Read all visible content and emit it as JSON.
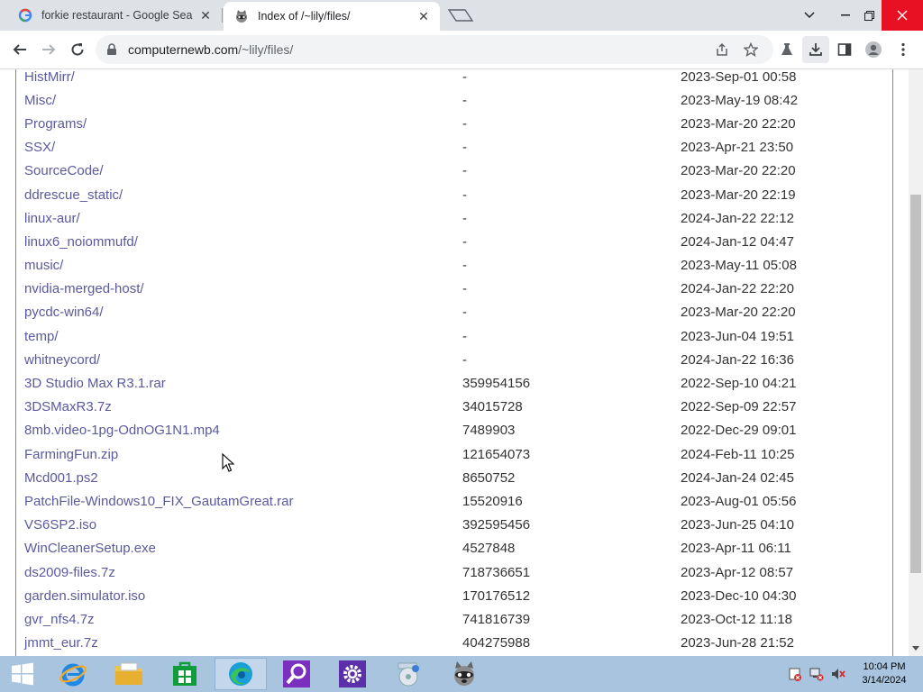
{
  "browser": {
    "tabs": [
      {
        "title": "forkie restaurant - Google Search",
        "favicon": "google-icon",
        "active": false
      },
      {
        "title": "Index of /~lily/files/",
        "favicon": "raccoon-icon",
        "active": true
      }
    ],
    "url_host": "computernewb.com",
    "url_path": "/~lily/files/"
  },
  "listing": {
    "rows": [
      {
        "name": "HistMirr/",
        "size": "-",
        "date": "2023-Sep-01 00:58"
      },
      {
        "name": "Misc/",
        "size": "-",
        "date": "2023-May-19 08:42"
      },
      {
        "name": "Programs/",
        "size": "-",
        "date": "2023-Mar-20 22:20"
      },
      {
        "name": "SSX/",
        "size": "-",
        "date": "2023-Apr-21 23:50"
      },
      {
        "name": "SourceCode/",
        "size": "-",
        "date": "2023-Mar-20 22:20"
      },
      {
        "name": "ddrescue_static/",
        "size": "-",
        "date": "2023-Mar-20 22:19"
      },
      {
        "name": "linux-aur/",
        "size": "-",
        "date": "2024-Jan-22 22:12"
      },
      {
        "name": "linux6_noiommufd/",
        "size": "-",
        "date": "2024-Jan-12 04:47"
      },
      {
        "name": "music/",
        "size": "-",
        "date": "2023-May-11 05:08"
      },
      {
        "name": "nvidia-merged-host/",
        "size": "-",
        "date": "2024-Jan-22 22:20"
      },
      {
        "name": "pycdc-win64/",
        "size": "-",
        "date": "2023-Mar-20 22:20"
      },
      {
        "name": "temp/",
        "size": "-",
        "date": "2023-Jun-04 19:51"
      },
      {
        "name": "whitneycord/",
        "size": "-",
        "date": "2024-Jan-22 16:36"
      },
      {
        "name": "3D Studio Max R3.1.rar",
        "size": "359954156",
        "date": "2022-Sep-10 04:21"
      },
      {
        "name": "3DSMaxR3.7z",
        "size": "34015728",
        "date": "2022-Sep-09 22:57"
      },
      {
        "name": "8mb.video-1pg-OdnOG1N1.mp4",
        "size": "7489903",
        "date": "2022-Dec-29 09:01"
      },
      {
        "name": "FarmingFun.zip",
        "size": "121654073",
        "date": "2024-Feb-11 10:25"
      },
      {
        "name": "Mcd001.ps2",
        "size": "8650752",
        "date": "2024-Jan-24 02:45"
      },
      {
        "name": "PatchFile-Windows10_FIX_GautamGreat.rar",
        "size": "15520916",
        "date": "2023-Aug-01 05:56"
      },
      {
        "name": "VS6SP2.iso",
        "size": "392595456",
        "date": "2023-Jun-25 04:10"
      },
      {
        "name": "WinCleanerSetup.exe",
        "size": "4527848",
        "date": "2023-Apr-11 06:11"
      },
      {
        "name": "ds2009-files.7z",
        "size": "718736651",
        "date": "2023-Apr-12 08:57"
      },
      {
        "name": "garden.simulator.iso",
        "size": "170176512",
        "date": "2023-Dec-10 04:30"
      },
      {
        "name": "gvr_nfs4.7z",
        "size": "741816739",
        "date": "2023-Oct-12 11:18"
      },
      {
        "name": "jmmt_eur.7z",
        "size": "404275988",
        "date": "2023-Jun-28 21:52"
      }
    ]
  },
  "taskbar": {
    "items": [
      "start-button",
      "internet-explorer-icon",
      "file-explorer-icon",
      "store-icon",
      "edge-icon",
      "search-app-icon",
      "settings-icon",
      "media-app-icon",
      "raccoon-app-icon"
    ],
    "clock_time": "10:04 PM",
    "clock_date": "3/14/2024"
  },
  "colors": {
    "link": "#5a5a9e",
    "taskbar": "#a9c4de",
    "tabstrip": "#dee1e6"
  }
}
